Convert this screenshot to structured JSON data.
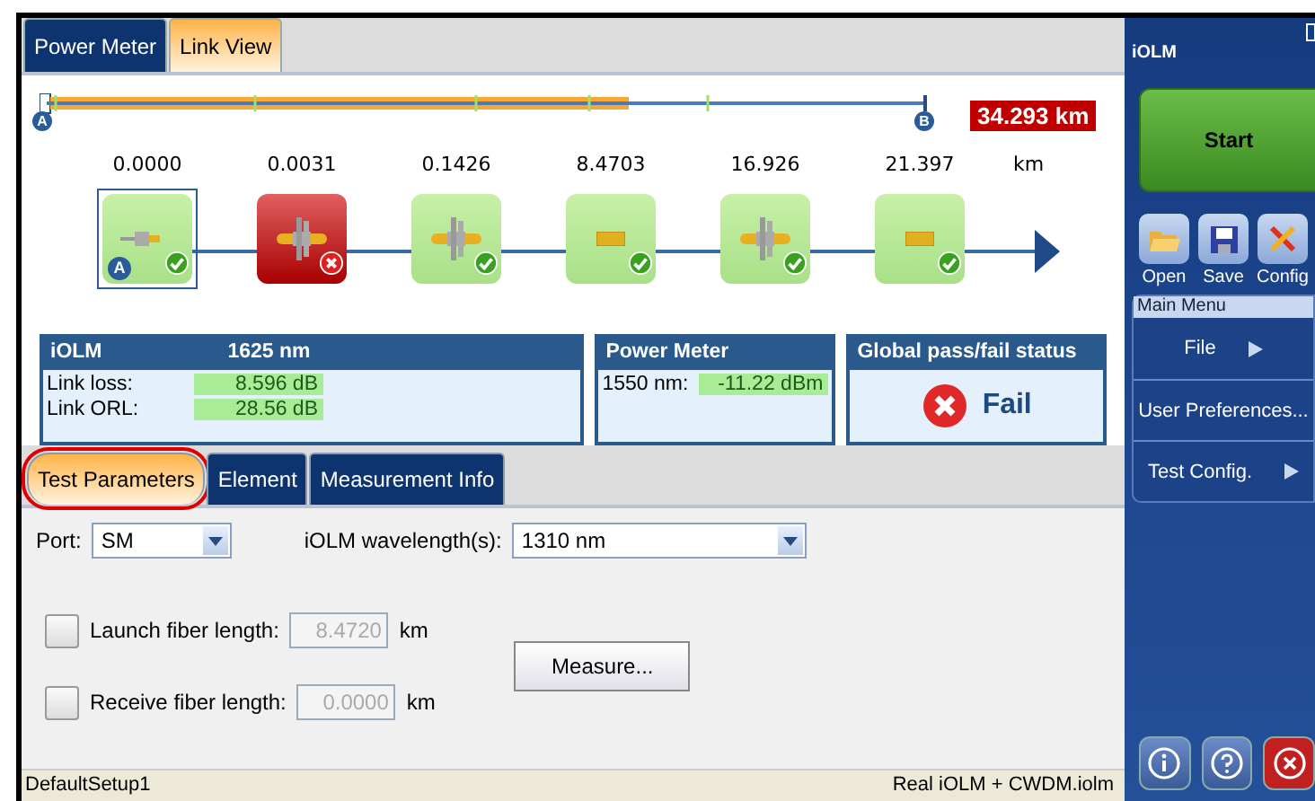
{
  "tabs": [
    {
      "label": "Power Meter",
      "selected": false
    },
    {
      "label": "Link View",
      "selected": true
    }
  ],
  "link_view": {
    "total_length": "34.293 km",
    "start_marker": "A",
    "end_marker": "B",
    "unit": "km",
    "events": [
      {
        "distance": "0.0000",
        "kind": "launch",
        "passed": true,
        "selected": true,
        "marker": "A"
      },
      {
        "distance": "0.0031",
        "kind": "connector",
        "passed": false,
        "selected": false
      },
      {
        "distance": "0.1426",
        "kind": "connector",
        "passed": true,
        "selected": false
      },
      {
        "distance": "8.4703",
        "kind": "splice",
        "passed": true,
        "selected": false
      },
      {
        "distance": "16.926",
        "kind": "connector",
        "passed": true,
        "selected": false
      },
      {
        "distance": "21.397",
        "kind": "splice",
        "passed": true,
        "selected": false
      }
    ]
  },
  "iolm_panel": {
    "title": "iOLM",
    "wavelength": "1625 nm",
    "rows": [
      {
        "label": "Link loss:",
        "value": "8.596 dB"
      },
      {
        "label": "Link ORL:",
        "value": "28.56 dB"
      }
    ]
  },
  "power_meter_panel": {
    "title": "Power Meter",
    "rows": [
      {
        "label": "1550 nm:",
        "value": "-11.22 dBm"
      }
    ]
  },
  "status_panel": {
    "title": "Global pass/fail status",
    "result": "Fail",
    "passed": false
  },
  "lower_tabs": [
    {
      "label": "Test Parameters",
      "selected": true,
      "circled": true
    },
    {
      "label": "Element",
      "selected": false,
      "circled": false
    },
    {
      "label": "Measurement Info",
      "selected": false,
      "circled": false
    }
  ],
  "test_parameters": {
    "port": {
      "label": "Port:",
      "value": "SM"
    },
    "wavelengths": {
      "label": "iOLM wavelength(s):",
      "value": "1310 nm"
    },
    "launch_fiber": {
      "label": "Launch fiber length:",
      "checked": false,
      "value": "8.4720",
      "unit": "km"
    },
    "receive_fiber": {
      "label": "Receive fiber length:",
      "checked": false,
      "value": "0.0000",
      "unit": "km"
    },
    "measure_button": "Measure..."
  },
  "status_bar": {
    "left": "DefaultSetup1",
    "right": "Real iOLM + CWDM.iolm"
  },
  "side_panel": {
    "title": "iOLM",
    "start_button": "Start",
    "tools": [
      {
        "kind": "open",
        "label": "Open"
      },
      {
        "kind": "save",
        "label": "Save"
      },
      {
        "kind": "config",
        "label": "Config"
      }
    ],
    "menu_title": "Main Menu",
    "menu": [
      {
        "label": "File",
        "submenu": true
      },
      {
        "label": "User Preferences...",
        "submenu": false
      },
      {
        "label": "Test Config.",
        "submenu": true
      }
    ],
    "bottom_buttons": [
      {
        "kind": "info"
      },
      {
        "kind": "help"
      },
      {
        "kind": "close"
      }
    ]
  }
}
